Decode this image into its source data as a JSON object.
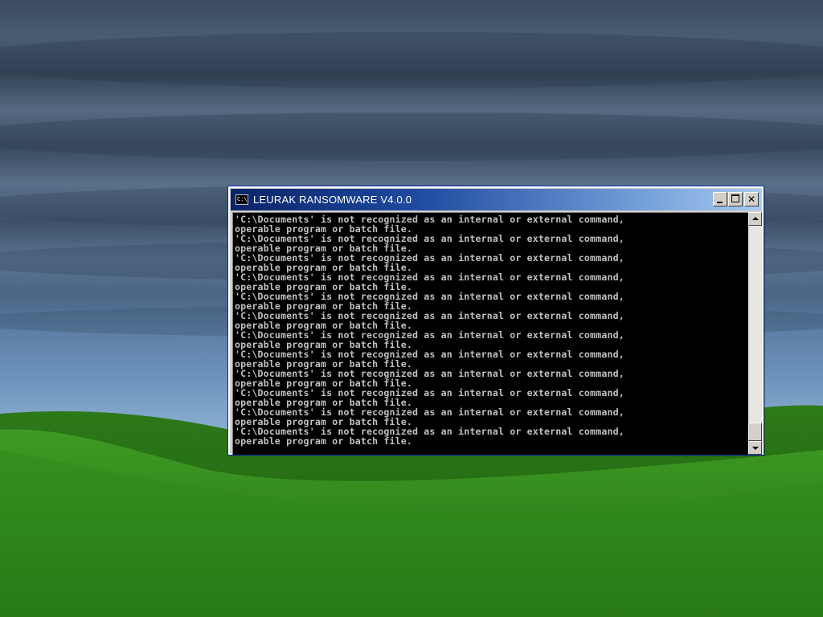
{
  "desktop": {
    "colors": {
      "sky_dark": "#3b4b5f",
      "sky_light": "#9cbad6",
      "grass_dark": "#1f6a12",
      "grass_light": "#4aa82a"
    }
  },
  "window": {
    "title": "LEURAK RANSOMWARE V4.0.0",
    "icon_glyph": "C:\\",
    "buttons": {
      "minimize_icon": "minimize-icon",
      "maximize_icon": "maximize-icon",
      "close_icon": "close-icon",
      "close_glyph": "✕"
    },
    "colors": {
      "title_start": "#0a246a",
      "title_end": "#a6caf0",
      "console_bg": "#000000",
      "console_fg": "#c0c0c0"
    }
  },
  "console": {
    "lines": [
      "'C:\\Documents' is not recognized as an internal or external command,",
      "operable program or batch file.",
      "'C:\\Documents' is not recognized as an internal or external command,",
      "operable program or batch file.",
      "'C:\\Documents' is not recognized as an internal or external command,",
      "operable program or batch file.",
      "'C:\\Documents' is not recognized as an internal or external command,",
      "operable program or batch file.",
      "'C:\\Documents' is not recognized as an internal or external command,",
      "operable program or batch file.",
      "'C:\\Documents' is not recognized as an internal or external command,",
      "operable program or batch file.",
      "'C:\\Documents' is not recognized as an internal or external command,",
      "operable program or batch file.",
      "'C:\\Documents' is not recognized as an internal or external command,",
      "operable program or batch file.",
      "'C:\\Documents' is not recognized as an internal or external command,",
      "operable program or batch file.",
      "'C:\\Documents' is not recognized as an internal or external command,",
      "operable program or batch file.",
      "'C:\\Documents' is not recognized as an internal or external command,",
      "operable program or batch file.",
      "'C:\\Documents' is not recognized as an internal or external command,",
      "operable program or batch file."
    ]
  },
  "scrollbar": {
    "up_icon": "scroll-up-arrow-icon",
    "down_icon": "scroll-down-arrow-icon",
    "position": 0.95
  }
}
